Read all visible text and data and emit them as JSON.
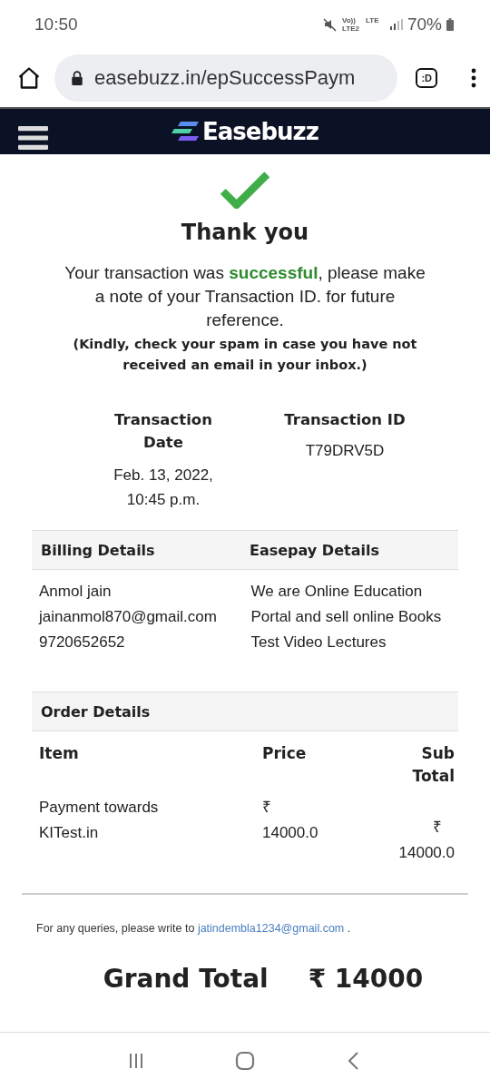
{
  "status_bar": {
    "time": "10:50",
    "network": [
      "Vo)) LTE2",
      "LTE"
    ],
    "battery": "70%"
  },
  "browser": {
    "url": "easebuzz.in/epSuccessPaym",
    "tab_count": ":D"
  },
  "header": {
    "logo": "Easebuzz"
  },
  "success": {
    "title": "Thank you",
    "message": "Your transaction was **successful**, please make a note of your Transaction ID. for future reference.",
    "note": "(Kindly, check your spam in case you have not received an email in your inbox.)"
  },
  "transaction": {
    "date_label": "Transaction Date",
    "date": "Feb. 13, 2022, 10:45 p.m.",
    "id_label": "Transaction ID",
    "id": "T79DRV5D"
  },
  "billing": {
    "heading": "Billing Details",
    "lines": [
      "Anmol jain",
      "jainanmol870@gmail.com",
      "9720652652"
    ]
  },
  "easepay": {
    "heading": "Easepay Details",
    "text": "We are Online Education Portal and sell online Books Test Video Lectures"
  },
  "order": {
    "heading": "Order Details",
    "columns": [
      "Item",
      "Price",
      "Sub Total"
    ],
    "rows": [
      {
        "item": "Payment towards KITest.in",
        "price": {
          "currency": "₹",
          "amount": "14000.0"
        },
        "subtotal": {
          "currency": "₹",
          "amount": "14000.0"
        }
      }
    ]
  },
  "queries": {
    "text": "For any queries, please write to",
    "email": "jatindembla1234@gmail.com",
    "end": "."
  },
  "grand_total": {
    "label": "Grand Total",
    "value": "₹ 14000"
  }
}
